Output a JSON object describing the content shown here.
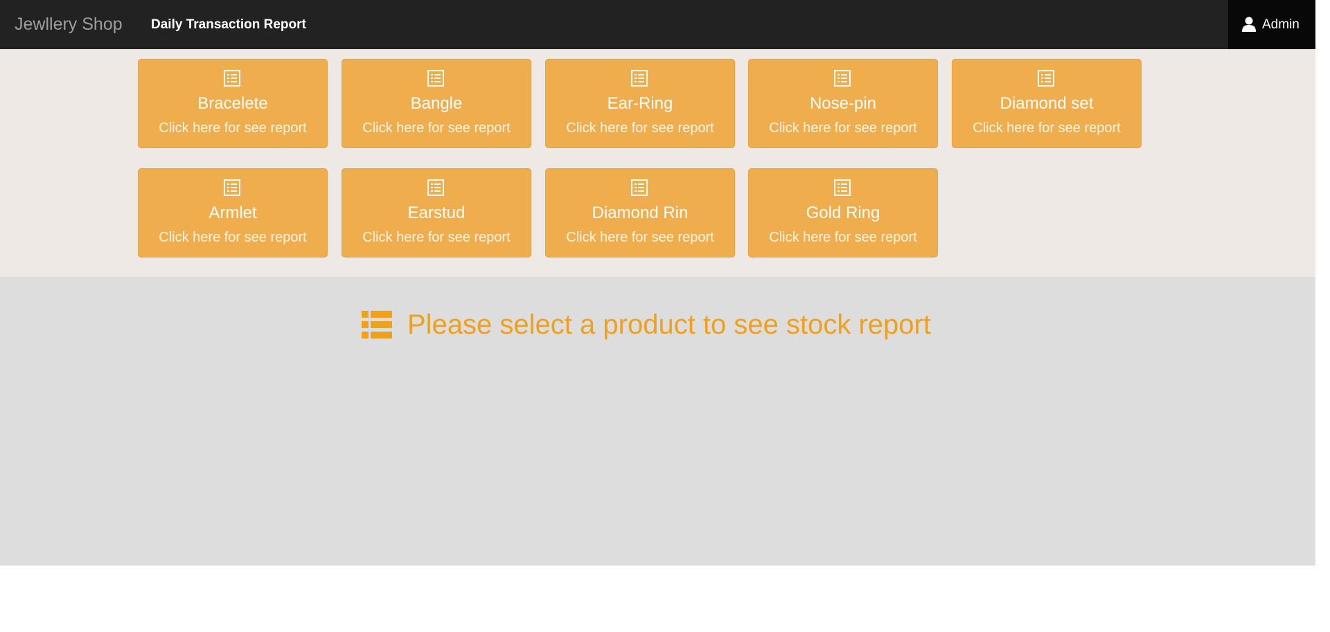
{
  "navbar": {
    "brand": "Jewllery Shop",
    "nav_link": "Daily Transaction Report",
    "user": {
      "icon": "user-icon",
      "name": "Admin"
    }
  },
  "tiles": [
    {
      "title": "Bracelete",
      "subtitle": "Click here for see report",
      "icon": "list-alt-icon"
    },
    {
      "title": "Bangle",
      "subtitle": "Click here for see report",
      "icon": "list-alt-icon"
    },
    {
      "title": "Ear-Ring",
      "subtitle": "Click here for see report",
      "icon": "list-alt-icon"
    },
    {
      "title": "Nose-pin",
      "subtitle": "Click here for see report",
      "icon": "list-alt-icon"
    },
    {
      "title": "Diamond set",
      "subtitle": "Click here for see report",
      "icon": "list-alt-icon"
    },
    {
      "title": "Armlet",
      "subtitle": "Click here for see report",
      "icon": "list-alt-icon"
    },
    {
      "title": "Earstud",
      "subtitle": "Click here for see report",
      "icon": "list-alt-icon"
    },
    {
      "title": "Diamond Rin",
      "subtitle": "Click here for see report",
      "icon": "list-alt-icon"
    },
    {
      "title": "Gold Ring",
      "subtitle": "Click here for see report",
      "icon": "list-alt-icon"
    }
  ],
  "report": {
    "icon": "th-list-icon",
    "message": "Please select a product to see stock report"
  },
  "colors": {
    "navbar_bg": "#222222",
    "tile_bg": "#f0ad4e",
    "tiles_area_bg": "#eee9e4",
    "report_area_bg": "#dddddd",
    "message_color": "#f0a11c"
  }
}
